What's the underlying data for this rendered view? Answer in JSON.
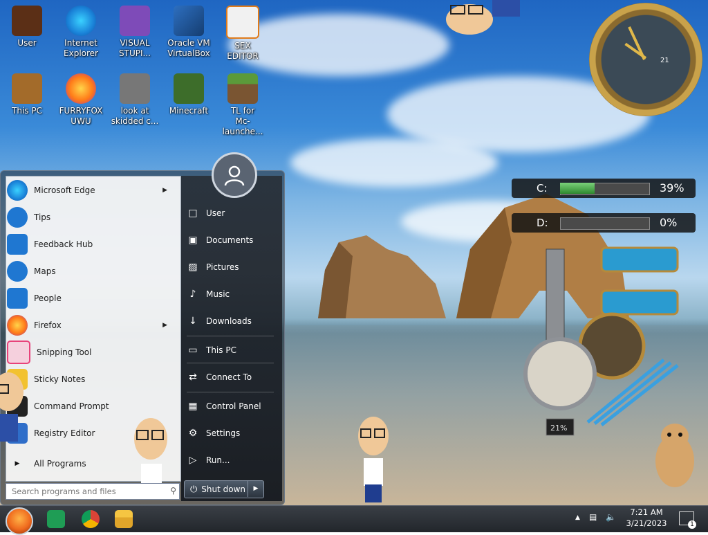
{
  "desktop": {
    "icons": [
      {
        "label": "User",
        "color": "#5b2f16"
      },
      {
        "label": "Internet\nExplorer",
        "color": "#1a82d8"
      },
      {
        "label": "VISUAL\nSTUPI...",
        "color": "#7e4bb8"
      },
      {
        "label": "Oracle VM\nVirtualBox",
        "color": "#1c5aa6"
      },
      {
        "label": "SEX\nEDITOR",
        "color": "#f1f1f1"
      },
      {
        "label": "This PC",
        "color": "#a36b2a"
      },
      {
        "label": "FURRYFOX\nUWU",
        "color": "#ff7a18"
      },
      {
        "label": "look at\nskidded c...",
        "color": "#777777"
      },
      {
        "label": "Minecraft",
        "color": "#3d6d2a"
      },
      {
        "label": "TL for\nMc-launche...",
        "color": "#5b9a3a"
      }
    ]
  },
  "start_menu": {
    "programs": [
      {
        "label": "Microsoft Edge",
        "has_submenu": true,
        "color": "#1a82d8"
      },
      {
        "label": "Tips",
        "has_submenu": false,
        "color": "#1f77d1"
      },
      {
        "label": "Feedback Hub",
        "has_submenu": false,
        "color": "#1f77d1"
      },
      {
        "label": "Maps",
        "has_submenu": false,
        "color": "#1f77d1"
      },
      {
        "label": "People",
        "has_submenu": false,
        "color": "#1f77d1"
      },
      {
        "label": "Firefox",
        "has_submenu": true,
        "color": "#ff7a18"
      },
      {
        "label": "Snipping Tool",
        "has_submenu": false,
        "color": "#e8427a"
      },
      {
        "label": "Sticky Notes",
        "has_submenu": false,
        "color": "#f2c230"
      },
      {
        "label": "Command Prompt",
        "has_submenu": false,
        "color": "#222222"
      },
      {
        "label": "Registry Editor",
        "has_submenu": false,
        "color": "#2f6ec9"
      }
    ],
    "all_programs": "All Programs",
    "search_placeholder": "Search programs and files",
    "places": [
      {
        "label": "User",
        "icon": "user-folder-icon",
        "glyph": "□"
      },
      {
        "label": "Documents",
        "icon": "documents-icon",
        "glyph": "▣"
      },
      {
        "label": "Pictures",
        "icon": "pictures-icon",
        "glyph": "▨"
      },
      {
        "label": "Music",
        "icon": "music-icon",
        "glyph": "♪"
      },
      {
        "label": "Downloads",
        "icon": "downloads-icon",
        "glyph": "↓"
      },
      {
        "label": "This PC",
        "icon": "computer-icon",
        "glyph": "▭"
      },
      {
        "label": "Connect To",
        "icon": "connect-icon",
        "glyph": "⇄"
      },
      {
        "label": "Control Panel",
        "icon": "control-panel-icon",
        "glyph": "▦"
      },
      {
        "label": "Settings",
        "icon": "settings-gear-icon",
        "glyph": "⚙"
      },
      {
        "label": "Run...",
        "icon": "run-icon",
        "glyph": "▷"
      }
    ],
    "shutdown_label": "Shut down"
  },
  "gadgets": {
    "drives": [
      {
        "label": "C:",
        "percent": "39%",
        "fraction": 0.39
      },
      {
        "label": "D:",
        "percent": "0%",
        "fraction": 0.0
      }
    ],
    "gauge_percent": "21%",
    "clock_date": "21"
  },
  "taskbar": {
    "time": "7:21 AM",
    "date": "3/21/2023",
    "notification_count": "1"
  }
}
